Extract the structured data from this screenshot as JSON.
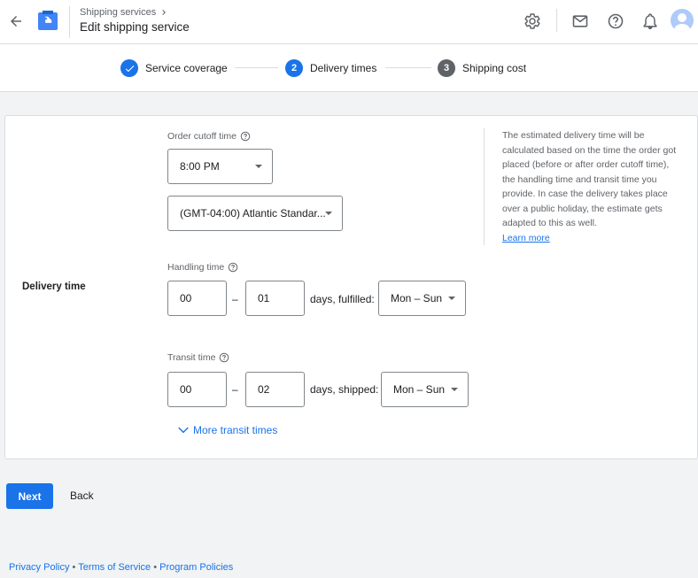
{
  "header": {
    "breadcrumb": "Shipping services",
    "title": "Edit shipping service"
  },
  "stepper": {
    "steps": [
      {
        "number": "✓",
        "label": "Service coverage",
        "state": "completed"
      },
      {
        "number": "2",
        "label": "Delivery times",
        "state": "active"
      },
      {
        "number": "3",
        "label": "Shipping cost",
        "state": "pending"
      }
    ]
  },
  "form": {
    "section_label": "Delivery time",
    "cutoff": {
      "label": "Order cutoff time",
      "time": "8:00 PM",
      "timezone": "(GMT-04:00) Atlantic Standar..."
    },
    "handling": {
      "label": "Handling time",
      "min": "00",
      "max": "01",
      "suffix": "days, fulfilled:",
      "days": "Mon – Sun"
    },
    "transit": {
      "label": "Transit time",
      "min": "00",
      "max": "02",
      "suffix": "days, shipped:",
      "days": "Mon – Sun"
    },
    "dash": "–",
    "more_link": "More transit times",
    "info": {
      "text": "The estimated delivery time will be calculated based on the time the order got placed (before or after order cutoff time), the handling time and transit time you provide. In case the delivery takes place over a public holiday, the estimate gets adapted to this as well.",
      "link": "Learn more"
    }
  },
  "actions": {
    "next": "Next",
    "back": "Back"
  },
  "footer": {
    "privacy": "Privacy Policy",
    "sep": " • ",
    "terms": "Terms of Service",
    "policies": "Program Policies"
  },
  "colors": {
    "primary": "#1a73e8",
    "pending_step": "#5f6368",
    "background": "#f1f3f4"
  }
}
